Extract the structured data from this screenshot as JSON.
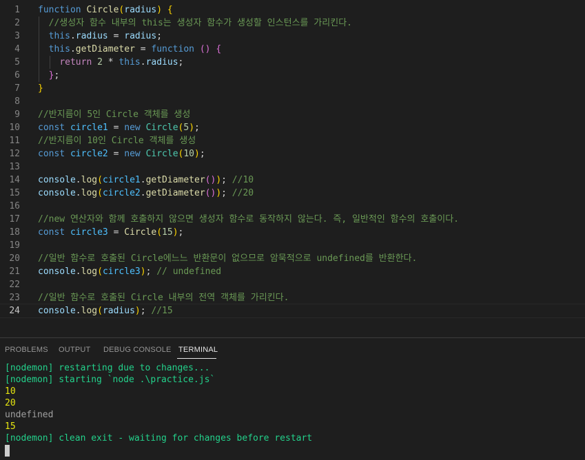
{
  "editor": {
    "current_line": 24,
    "lines": [
      {
        "n": "1",
        "tokens": [
          [
            "kw",
            "function "
          ],
          [
            "fn",
            "Circle"
          ],
          [
            "b1",
            "("
          ],
          [
            "var",
            "radius"
          ],
          [
            "b1",
            ")"
          ],
          [
            "op",
            " "
          ],
          [
            "b1",
            "{"
          ]
        ]
      },
      {
        "n": "2",
        "tokens": [
          [
            "op",
            "  "
          ],
          [
            "cmt",
            "//생성자 함수 내부의 this는 생성자 함수가 생성할 인스턴스를 가리킨다."
          ]
        ]
      },
      {
        "n": "3",
        "tokens": [
          [
            "op",
            "  "
          ],
          [
            "kw",
            "this"
          ],
          [
            "op",
            "."
          ],
          [
            "var",
            "radius"
          ],
          [
            "op",
            " = "
          ],
          [
            "var",
            "radius"
          ],
          [
            "op",
            ";"
          ]
        ]
      },
      {
        "n": "4",
        "tokens": [
          [
            "op",
            "  "
          ],
          [
            "kw",
            "this"
          ],
          [
            "op",
            "."
          ],
          [
            "fn",
            "getDiameter"
          ],
          [
            "op",
            " = "
          ],
          [
            "kw",
            "function"
          ],
          [
            "op",
            " "
          ],
          [
            "b2",
            "("
          ],
          [
            "b2",
            ")"
          ],
          [
            "op",
            " "
          ],
          [
            "b2",
            "{"
          ]
        ]
      },
      {
        "n": "5",
        "tokens": [
          [
            "op",
            "    "
          ],
          [
            "ctl",
            "return"
          ],
          [
            "op",
            " "
          ],
          [
            "num",
            "2"
          ],
          [
            "op",
            " * "
          ],
          [
            "kw",
            "this"
          ],
          [
            "op",
            "."
          ],
          [
            "var",
            "radius"
          ],
          [
            "op",
            ";"
          ]
        ]
      },
      {
        "n": "6",
        "tokens": [
          [
            "op",
            "  "
          ],
          [
            "b2",
            "}"
          ],
          [
            "op",
            ";"
          ]
        ]
      },
      {
        "n": "7",
        "tokens": [
          [
            "b1",
            "}"
          ]
        ]
      },
      {
        "n": "8",
        "tokens": []
      },
      {
        "n": "9",
        "tokens": [
          [
            "cmt",
            "//반지름이 5인 Circle 객체를 생성"
          ]
        ]
      },
      {
        "n": "10",
        "tokens": [
          [
            "kw",
            "const "
          ],
          [
            "cvar",
            "circle1"
          ],
          [
            "op",
            " = "
          ],
          [
            "kw",
            "new "
          ],
          [
            "cls",
            "Circle"
          ],
          [
            "b1",
            "("
          ],
          [
            "num",
            "5"
          ],
          [
            "b1",
            ")"
          ],
          [
            "op",
            ";"
          ]
        ]
      },
      {
        "n": "11",
        "tokens": [
          [
            "cmt",
            "//반지름이 10인 Circle 객체를 생성"
          ]
        ]
      },
      {
        "n": "12",
        "tokens": [
          [
            "kw",
            "const "
          ],
          [
            "cvar",
            "circle2"
          ],
          [
            "op",
            " = "
          ],
          [
            "kw",
            "new "
          ],
          [
            "cls",
            "Circle"
          ],
          [
            "b1",
            "("
          ],
          [
            "num",
            "10"
          ],
          [
            "b1",
            ")"
          ],
          [
            "op",
            ";"
          ]
        ]
      },
      {
        "n": "13",
        "tokens": []
      },
      {
        "n": "14",
        "tokens": [
          [
            "var",
            "console"
          ],
          [
            "op",
            "."
          ],
          [
            "fn",
            "log"
          ],
          [
            "b1",
            "("
          ],
          [
            "cvar",
            "circle1"
          ],
          [
            "op",
            "."
          ],
          [
            "fn",
            "getDiameter"
          ],
          [
            "b2",
            "("
          ],
          [
            "b2",
            ")"
          ],
          [
            "b1",
            ")"
          ],
          [
            "op",
            "; "
          ],
          [
            "cmt",
            "//10"
          ]
        ]
      },
      {
        "n": "15",
        "tokens": [
          [
            "var",
            "console"
          ],
          [
            "op",
            "."
          ],
          [
            "fn",
            "log"
          ],
          [
            "b1",
            "("
          ],
          [
            "cvar",
            "circle2"
          ],
          [
            "op",
            "."
          ],
          [
            "fn",
            "getDiameter"
          ],
          [
            "b2",
            "("
          ],
          [
            "b2",
            ")"
          ],
          [
            "b1",
            ")"
          ],
          [
            "op",
            "; "
          ],
          [
            "cmt",
            "//20"
          ]
        ]
      },
      {
        "n": "16",
        "tokens": []
      },
      {
        "n": "17",
        "tokens": [
          [
            "cmt",
            "//new 연산자와 함께 호출하지 않으면 생성자 함수로 동작하지 않는다. 즉, 일반적인 함수의 호출이다."
          ]
        ]
      },
      {
        "n": "18",
        "tokens": [
          [
            "kw",
            "const "
          ],
          [
            "cvar",
            "circle3"
          ],
          [
            "op",
            " = "
          ],
          [
            "fn",
            "Circle"
          ],
          [
            "b1",
            "("
          ],
          [
            "num",
            "15"
          ],
          [
            "b1",
            ")"
          ],
          [
            "op",
            ";"
          ]
        ]
      },
      {
        "n": "19",
        "tokens": []
      },
      {
        "n": "20",
        "tokens": [
          [
            "cmt",
            "//일반 함수로 호출된 Circle에느느 반환문이 없으므로 암묵적으로 undefined를 반환한다."
          ]
        ]
      },
      {
        "n": "21",
        "tokens": [
          [
            "var",
            "console"
          ],
          [
            "op",
            "."
          ],
          [
            "fn",
            "log"
          ],
          [
            "b1",
            "("
          ],
          [
            "cvar",
            "circle3"
          ],
          [
            "b1",
            ")"
          ],
          [
            "op",
            "; "
          ],
          [
            "cmt",
            "// undefined"
          ]
        ]
      },
      {
        "n": "22",
        "tokens": []
      },
      {
        "n": "23",
        "tokens": [
          [
            "cmt",
            "//일반 함수로 호출된 Circle 내부의 전역 객체를 가리킨다."
          ]
        ]
      },
      {
        "n": "24",
        "tokens": [
          [
            "var",
            "console"
          ],
          [
            "op",
            "."
          ],
          [
            "fn",
            "log"
          ],
          [
            "b1",
            "("
          ],
          [
            "var",
            "radius"
          ],
          [
            "b1",
            ")"
          ],
          [
            "op",
            "; "
          ],
          [
            "cmt",
            "//15"
          ]
        ]
      }
    ]
  },
  "panel": {
    "tabs": [
      {
        "label": "PROBLEMS",
        "active": false
      },
      {
        "label": "OUTPUT",
        "active": false
      },
      {
        "label": "DEBUG CONSOLE",
        "active": false
      },
      {
        "label": "TERMINAL",
        "active": true
      }
    ]
  },
  "terminal": {
    "lines": [
      {
        "text": "[nodemon] restarting due to changes...",
        "color": "#23d18b"
      },
      {
        "text": "[nodemon] starting `node .\\practice.js`",
        "color": "#23d18b"
      },
      {
        "text": "10",
        "color": "#e5e510"
      },
      {
        "text": "20",
        "color": "#e5e510"
      },
      {
        "text": "undefined",
        "color": "#a0a0a0"
      },
      {
        "text": "15",
        "color": "#e5e510"
      },
      {
        "text": "[nodemon] clean exit - waiting for changes before restart",
        "color": "#23d18b"
      }
    ]
  },
  "colors": {
    "background": "#1e1e1e",
    "keyword": "#569cd6",
    "function": "#dcdcaa",
    "comment": "#6a9955",
    "variable": "#9cdcfe",
    "number": "#b5cea8",
    "class": "#4ec9b0"
  }
}
